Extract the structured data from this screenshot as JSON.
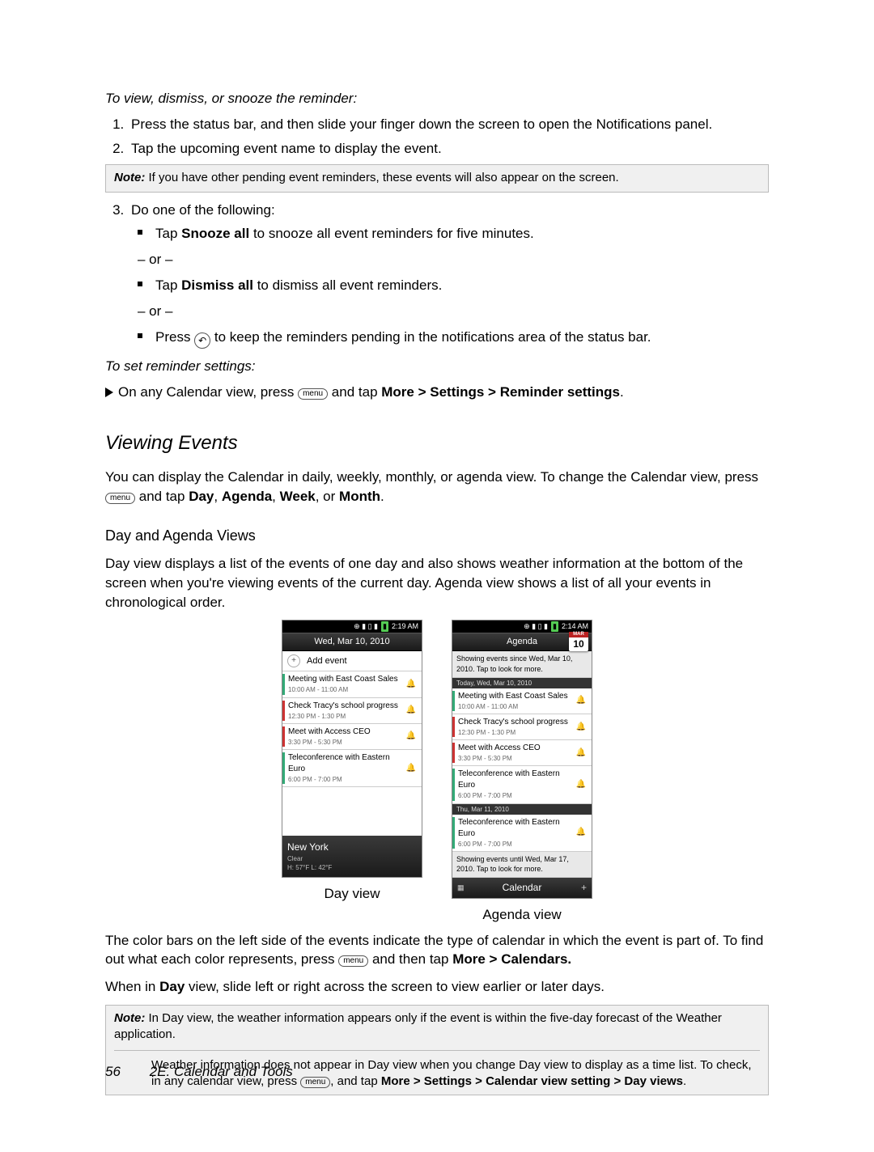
{
  "headings": {
    "task1": "To view, dismiss, or snooze the reminder:",
    "task2": "To set reminder settings:",
    "section": "Viewing Events",
    "subsection": "Day and Agenda Views"
  },
  "list": {
    "step1": "Press the status bar, and then slide your finger down the screen to open the Notifications panel.",
    "step2": "Tap the upcoming event name to display the event.",
    "step3": "Do one of the following:",
    "snooze_pre": "Tap ",
    "snooze_b": "Snooze all",
    "snooze_post": " to snooze all event reminders for five minutes.",
    "dismiss_pre": "Tap ",
    "dismiss_b": "Dismiss all",
    "dismiss_post": " to dismiss all event reminders.",
    "press_pre": "Press ",
    "press_post": " to keep the reminders pending in the notifications area of the status bar.",
    "or": "– or –"
  },
  "note1": {
    "label": "Note:",
    "text": "If you have other pending event reminders, these events will also appear on the screen."
  },
  "reminder": {
    "pre": "On any Calendar view, press ",
    "mid": " and tap ",
    "more": "More",
    "gt": " > ",
    "settings": "Settings",
    "reminder": "Reminder settings",
    "dot": "."
  },
  "viewing_p1_a": "You can display the Calendar in daily, weekly, monthly, or agenda view. To change the Calendar view, press ",
  "viewing_p1_b": " and tap ",
  "viewing_day": "Day",
  "viewing_agenda": "Agenda",
  "viewing_week": "Week",
  "viewing_month": "Month",
  "viewing_or": ", or ",
  "viewing_comma": ", ",
  "viewing_dot": ".",
  "day_p": "Day view displays a list of the events of one day and also shows weather information at the bottom of the screen when you're viewing events of the current day. Agenda view shows a list of all your events in chronological order.",
  "color_p_a": "The color bars on the left side of the events indicate the type of calendar in which the event is part of. To find out what each color represents, press ",
  "color_p_b": " and then tap ",
  "color_more": "More",
  "color_gt": " > ",
  "color_cal": "Calendars.",
  "slide_p_a": "When in ",
  "slide_day": "Day",
  "slide_p_b": " view, slide left or right across the screen to view earlier or later days.",
  "note2": {
    "label": "Note:",
    "line1": "In Day view, the weather information appears only if the event is within the five-day forecast of the Weather application.",
    "line2a": "Weather information does not appear in Day view when you change Day view to display as a time list. To check, in any calendar view, press ",
    "line2b": ", and tap ",
    "more": "More",
    "gt": " > ",
    "settings": "Settings",
    "cvs": "Calendar view setting",
    "dv": "Day views",
    "dot": "."
  },
  "footer": {
    "page": "56",
    "chapter": "2E. Calendar and Tools"
  },
  "menu_glyph": "menu",
  "back_glyph": "↶",
  "shots": {
    "day": {
      "time": "2:19 AM",
      "title": "Wed, Mar 10, 2010",
      "add": "Add event",
      "events": [
        {
          "t": "Meeting with East Coast Sales",
          "s": "10:00 AM - 11:00 AM",
          "c": "#3a7"
        },
        {
          "t": "Check Tracy's school progress",
          "s": "12:30 PM - 1:30 PM",
          "c": "#c33"
        },
        {
          "t": "Meet with Access CEO",
          "s": "3:30 PM - 5:30 PM",
          "c": "#c33"
        },
        {
          "t": "Teleconference with Eastern Euro",
          "s": "6:00 PM - 7:00 PM",
          "c": "#3a7"
        }
      ],
      "city": "New York",
      "clear": "Clear",
      "temp": "H: 57°F   L: 42°F",
      "label": "Day view"
    },
    "agenda": {
      "time": "2:14 AM",
      "title": "Agenda",
      "month": "MAR",
      "daynum": "10",
      "top": "Showing events since Wed, Mar 10, 2010. Tap to look for more.",
      "sep1": "Today, Wed, Mar 10, 2010",
      "events": [
        {
          "t": "Meeting with East Coast Sales",
          "s": "10:00 AM - 11:00 AM",
          "c": "#3a7"
        },
        {
          "t": "Check Tracy's school progress",
          "s": "12:30 PM - 1:30 PM",
          "c": "#c33"
        },
        {
          "t": "Meet with Access CEO",
          "s": "3:30 PM - 5:30 PM",
          "c": "#c33"
        },
        {
          "t": "Teleconference with Eastern Euro",
          "s": "6:00 PM - 7:00 PM",
          "c": "#3a7"
        }
      ],
      "sep2": "Thu, Mar 11, 2010",
      "events2": [
        {
          "t": "Teleconference with Eastern Euro",
          "s": "6:00 PM - 7:00 PM",
          "c": "#3a7"
        }
      ],
      "bottom": "Showing events until Wed, Mar 17, 2010. Tap to look for more.",
      "footer": "Calendar",
      "label": "Agenda view"
    }
  }
}
